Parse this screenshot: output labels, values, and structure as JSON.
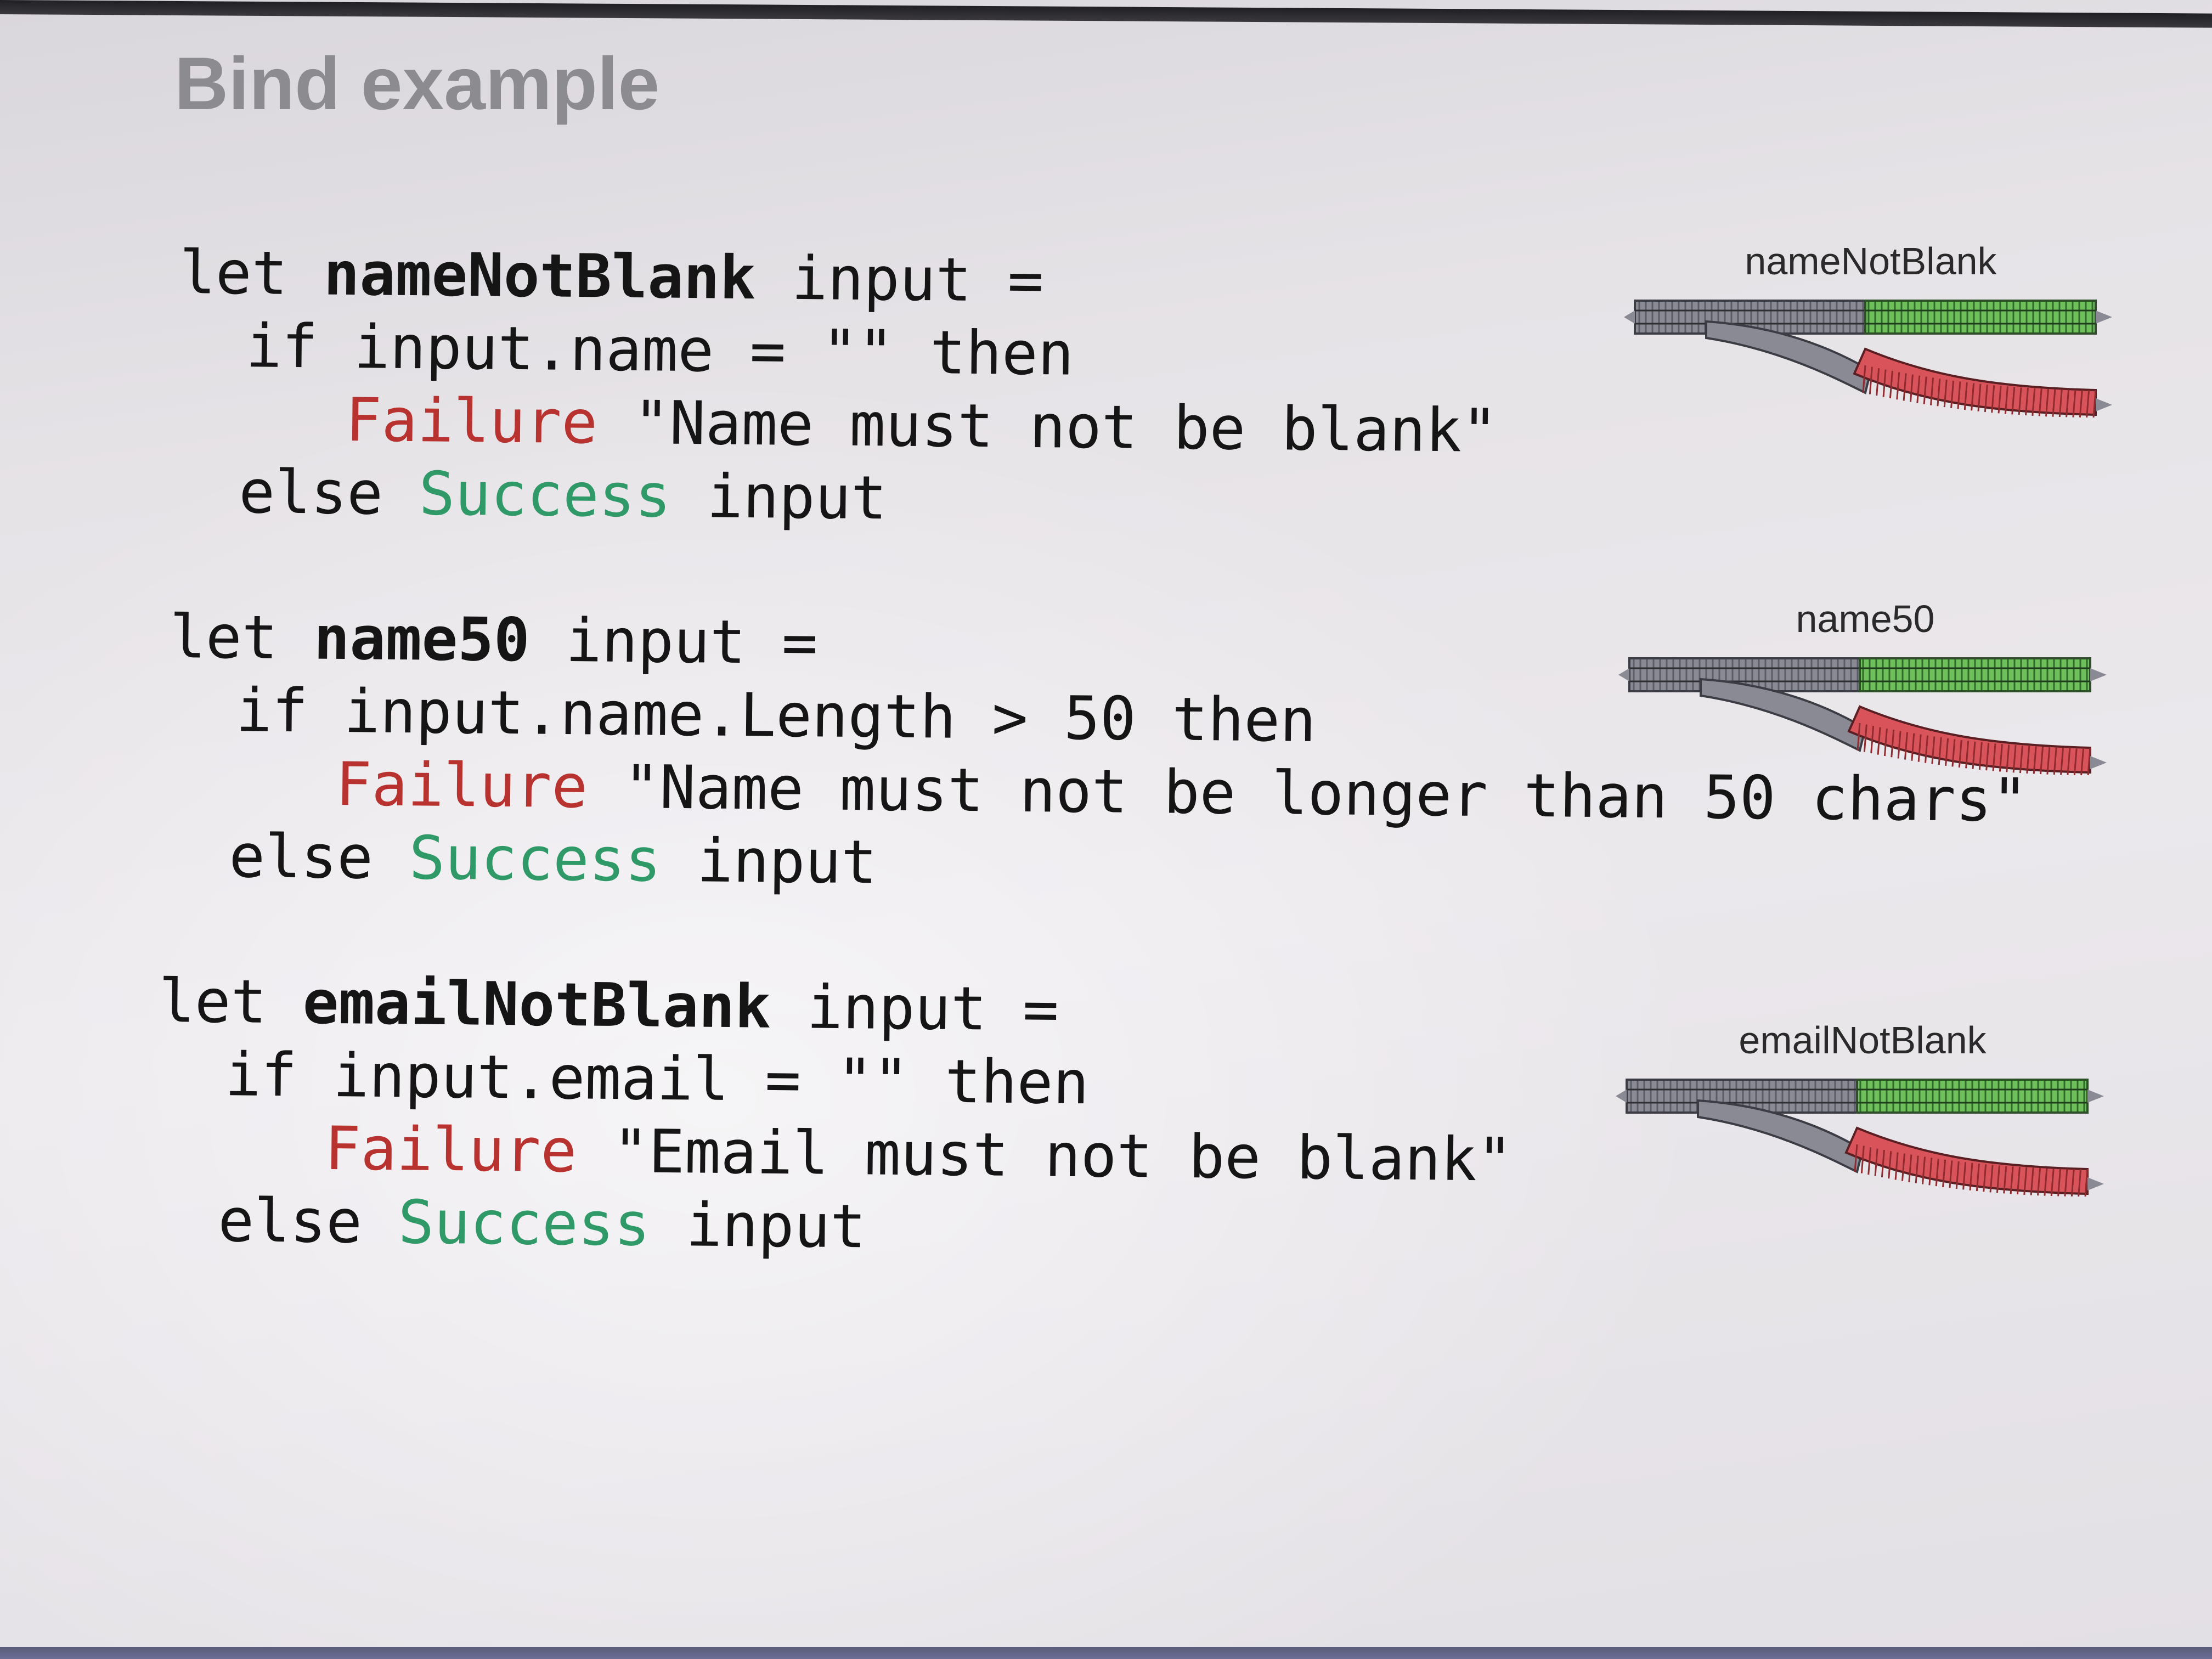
{
  "slide": {
    "title": "Bind example"
  },
  "code_blocks": [
    {
      "name": "nameNotBlank",
      "lines": [
        {
          "kw": "let ",
          "fn": "nameNotBlank",
          "rest": " input ="
        },
        {
          "text": "if input.name = \"\" then"
        },
        {
          "failure": "Failure",
          "rest": " \"Name must not be blank\""
        },
        {
          "pre": "else ",
          "success": "Success",
          "rest": " input"
        }
      ]
    },
    {
      "name": "name50",
      "lines": [
        {
          "kw": "let ",
          "fn": "name50",
          "rest": " input ="
        },
        {
          "text": "if input.name.Length > 50 then"
        },
        {
          "failure": "Failure",
          "rest": " \"Name must not be longer than 50 chars\""
        },
        {
          "pre": "else ",
          "success": "Success",
          "rest": " input"
        }
      ]
    },
    {
      "name": "emailNotBlank",
      "lines": [
        {
          "kw": "let ",
          "fn": "emailNotBlank",
          "rest": " input ="
        },
        {
          "text": "if input.email = \"\" then"
        },
        {
          "failure": "Failure",
          "rest": " \"Email must not be blank\""
        },
        {
          "pre": "else ",
          "success": "Success",
          "rest": " input"
        }
      ]
    }
  ],
  "diagrams": [
    {
      "label": "nameNotBlank"
    },
    {
      "label": "name50"
    },
    {
      "label": "emailNotBlank"
    }
  ],
  "colors": {
    "failure": "#b8322f",
    "success": "#2f9a67",
    "track_gray": "#8a8a95",
    "track_green": "#6fbf5a",
    "track_red": "#d9535a"
  }
}
